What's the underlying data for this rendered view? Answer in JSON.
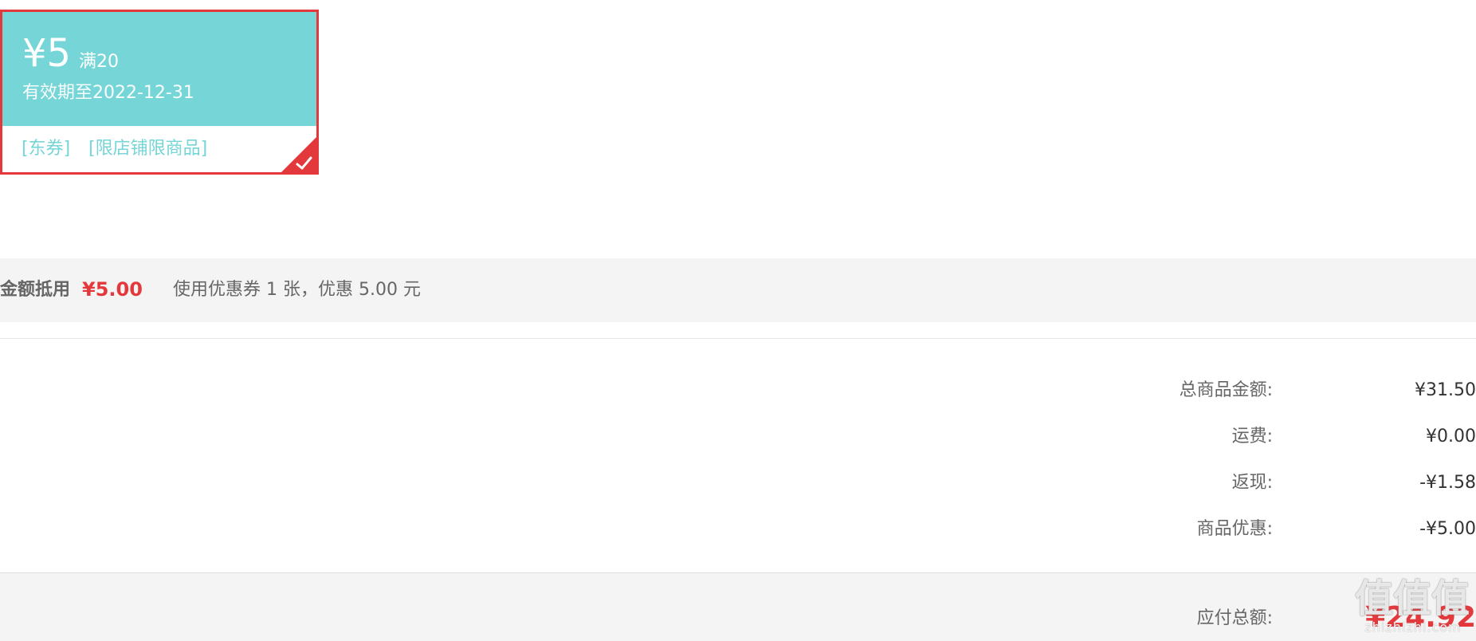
{
  "coupon": {
    "amount": "¥5",
    "condition": "满20",
    "validity": "有效期至2022-12-31",
    "tags": [
      "[东券]",
      "[限店铺限商品]"
    ],
    "selected": true,
    "colors": {
      "card_bg": "#76d5d6",
      "selected_border": "#e4393c"
    },
    "icon": "checkmark-icon"
  },
  "deduction": {
    "label": "金额抵用",
    "amount": "¥5.00",
    "description": "使用优惠券 1 张，优惠 5.00 元"
  },
  "summary": {
    "rows": [
      {
        "label": "总商品金额:",
        "value": "¥31.50"
      },
      {
        "label": "运费:",
        "value": "¥0.00"
      },
      {
        "label": "返现:",
        "value": "-¥1.58"
      },
      {
        "label": "商品优惠:",
        "value": "-¥5.00"
      }
    ],
    "total_label": "应付总额:",
    "total_value": "¥24.92"
  },
  "watermark": {
    "glyphs": "值值值",
    "site": "zhizhizhi.com"
  },
  "colors": {
    "accent_red": "#e4393c",
    "bar_bg": "#f4f4f4",
    "text": "#666666"
  }
}
